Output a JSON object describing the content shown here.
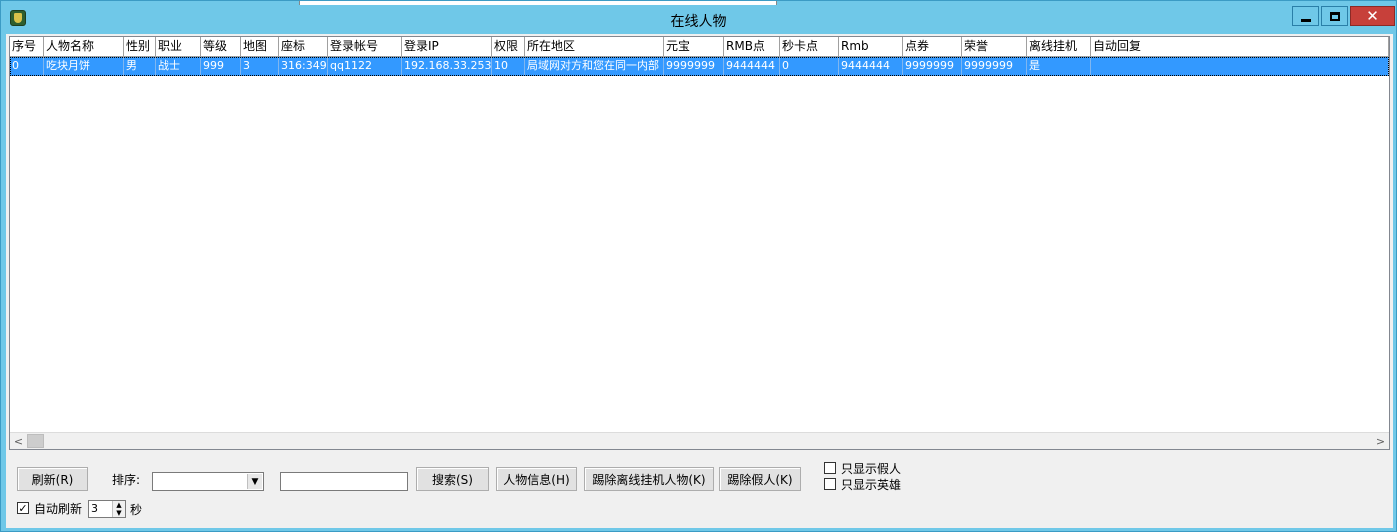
{
  "window": {
    "title": "在线人物",
    "icon": "game-app-icon"
  },
  "table": {
    "columns": [
      {
        "label": "序号"
      },
      {
        "label": "人物名称"
      },
      {
        "label": "性别"
      },
      {
        "label": "职业"
      },
      {
        "label": "等级"
      },
      {
        "label": "地图"
      },
      {
        "label": "座标"
      },
      {
        "label": "登录帐号"
      },
      {
        "label": "登录IP"
      },
      {
        "label": "权限"
      },
      {
        "label": "所在地区"
      },
      {
        "label": "元宝"
      },
      {
        "label": "RMB点"
      },
      {
        "label": "秒卡点"
      },
      {
        "label": "Rmb"
      },
      {
        "label": "点券"
      },
      {
        "label": "荣誉"
      },
      {
        "label": "离线挂机"
      },
      {
        "label": "自动回复"
      }
    ],
    "rows": [
      {
        "selected": true,
        "cells": [
          "0",
          "吃块月饼",
          "男",
          "战士",
          "999",
          "3",
          "316:349",
          "qq1122",
          "192.168.33.253",
          "10",
          "局域网对方和您在同一内部",
          "9999999",
          "9444444",
          "0",
          "9444444",
          "9999999",
          "9999999",
          "是",
          ""
        ]
      }
    ]
  },
  "controls": {
    "refresh_button": "刷新(R)",
    "sort_label": "排序:",
    "sort_value": "",
    "search_value": "",
    "search_button": "搜索(S)",
    "info_button": "人物信息(H)",
    "kick_offline_button": "踢除离线挂机人物(K)",
    "kick_fake_button": "踢除假人(K)",
    "only_fake_label": "只显示假人",
    "only_fake_checked": false,
    "only_hero_label": "只显示英雄",
    "only_hero_checked": false,
    "auto_refresh_label": "自动刷新",
    "auto_refresh_checked": true,
    "auto_refresh_interval": "3",
    "seconds_label": "秒"
  },
  "colors": {
    "titlebar": "#6fc8e8",
    "selection": "#3399ff",
    "close_button": "#c7403a"
  }
}
